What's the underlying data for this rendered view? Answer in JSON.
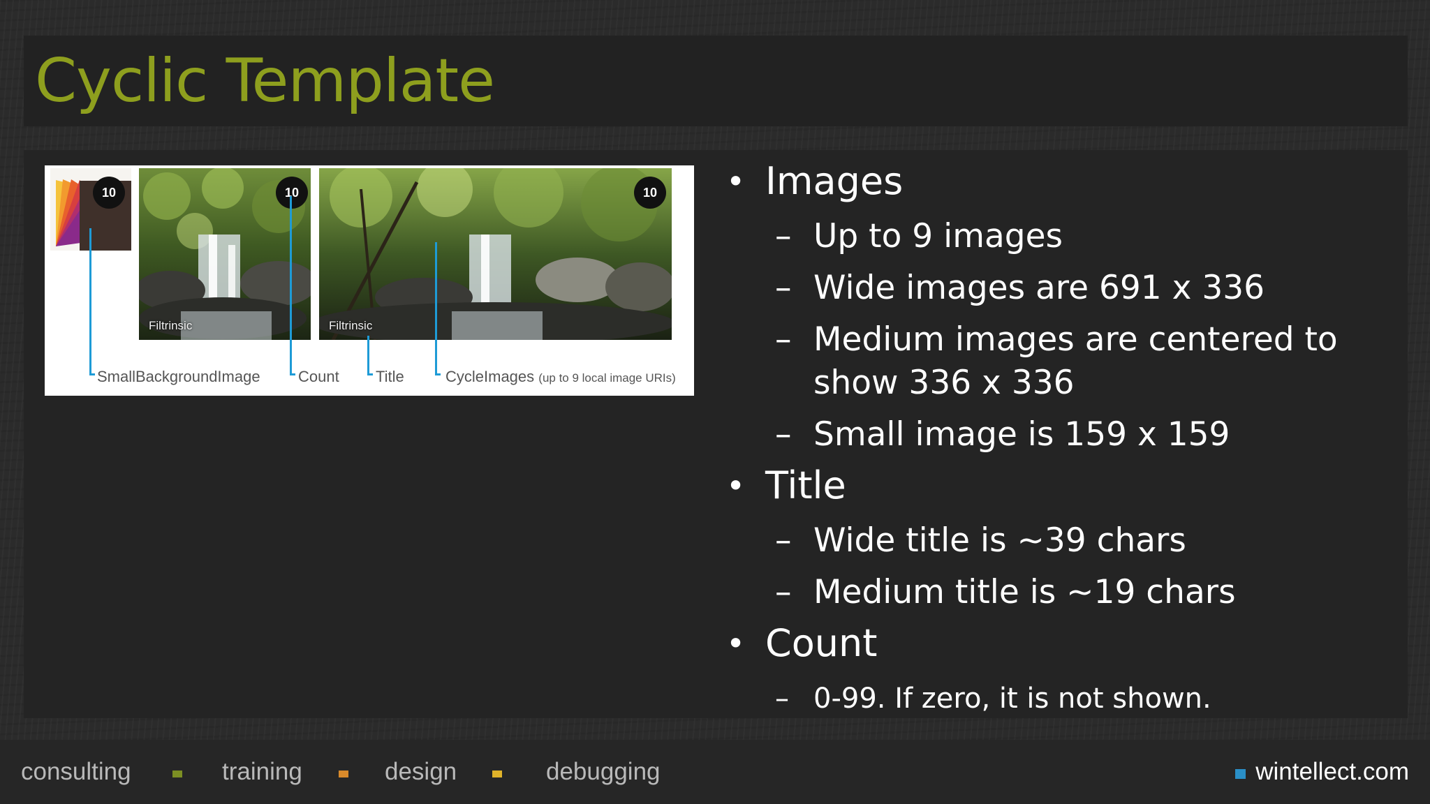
{
  "slide": {
    "title": "Cyclic Template"
  },
  "diagram": {
    "badge_count": "10",
    "tile_title": "Filtrinsic",
    "callouts": {
      "small_background": "SmallBackgroundImage",
      "count": "Count",
      "title": "Title",
      "cycle_images": "CycleImages",
      "cycle_images_note": "(up to 9 local image URIs)"
    },
    "colors": {
      "leader_line": "#1e9bd6",
      "palette": [
        "#f5c33b",
        "#f29a2e",
        "#e8612c",
        "#d73f3f",
        "#b02e6e",
        "#8a2a8a"
      ]
    }
  },
  "bullets": [
    {
      "text": "Images",
      "subs": [
        "Up to 9 images",
        "Wide images are 691 x 336",
        "Medium images are centered to show 336 x 336",
        "Small image is 159 x 159"
      ]
    },
    {
      "text": "Title",
      "subs": [
        "Wide title is ~39 chars",
        "Medium title is ~19 chars"
      ]
    },
    {
      "text": "Count",
      "subs": [
        "0-99.  If zero, it is not shown."
      ]
    }
  ],
  "footer": {
    "items": [
      "consulting",
      "training",
      "design",
      "debugging"
    ],
    "separator_colors": [
      "#7c8f23",
      "#d98a2b",
      "#e0b32a"
    ],
    "site": "wintellect.com",
    "site_marker_color": "#2a8fc7"
  },
  "colors": {
    "title_accent": "#8e9f1e",
    "background": "#2b2b2b",
    "panel": "#242424"
  }
}
